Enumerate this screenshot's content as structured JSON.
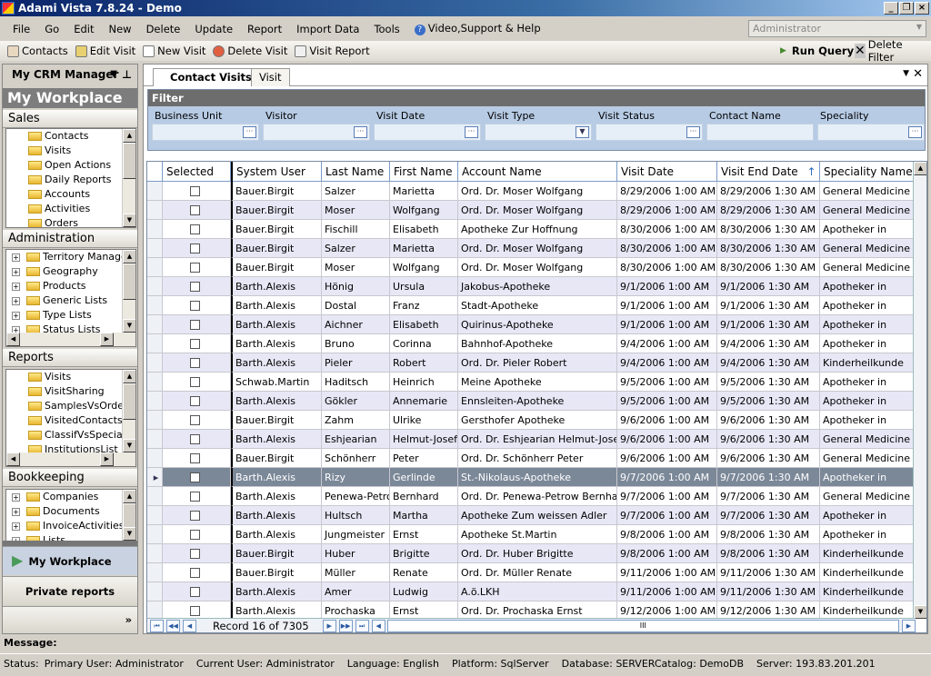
{
  "window": {
    "title": "Adami Vista 7.8.24 - Demo"
  },
  "menu": [
    "File",
    "Go",
    "Edit",
    "New",
    "Delete",
    "Update",
    "Report",
    "Import Data",
    "Tools",
    "Video,Support & Help"
  ],
  "user_combo": "Administrator",
  "toolbar": {
    "contacts": "Contacts",
    "edit_visit": "Edit Visit",
    "new_visit": "New Visit",
    "delete_visit": "Delete Visit",
    "visit_report": "Visit Report",
    "run_query": "Run Query",
    "delete_filter": "Delete Filter"
  },
  "sidebar": {
    "header": "My CRM Manager",
    "workplace_title": "My Workplace",
    "sections": [
      {
        "title": "Sales",
        "items": [
          "Contacts",
          "Visits",
          "Open Actions",
          "Daily Reports",
          "Accounts",
          "Activities",
          "Orders"
        ]
      },
      {
        "title": "Administration",
        "items": [
          "Territory Managen",
          "Geography",
          "Products",
          "Generic Lists",
          "Type Lists",
          "Status Lists"
        ]
      },
      {
        "title": "Reports",
        "items": [
          "Visits",
          "VisitSharing",
          "SamplesVsOrders",
          "VisitedContacts",
          "ClassifVsSpeciality",
          "InstitutionsList"
        ]
      },
      {
        "title": "Bookkeeping",
        "items": [
          "Companies",
          "Documents",
          "InvoiceActivities",
          "Lists"
        ]
      }
    ],
    "nav_workplace": "My Workplace",
    "nav_private": "Private reports",
    "more": "»"
  },
  "tabs": [
    "Contact Visits",
    "Visit"
  ],
  "filter": {
    "title": "Filter",
    "fields": [
      "Business Unit",
      "Visitor",
      "Visit Date",
      "Visit Type",
      "Visit Status",
      "Contact Name",
      "Speciality"
    ]
  },
  "grid": {
    "columns": [
      "Selected",
      "System User",
      "Last Name",
      "First Name",
      "Account Name",
      "Visit Date",
      "Visit End Date",
      "Speciality Name"
    ],
    "sort_column": "Visit End Date",
    "selected_row": 15,
    "rows": [
      [
        "Bauer.Birgit",
        "Salzer",
        "Marietta",
        "Ord. Dr. Moser Wolfgang",
        "8/29/2006 1:00 AM",
        "8/29/2006 1:30 AM",
        "General Medicine"
      ],
      [
        "Bauer.Birgit",
        "Moser",
        "Wolfgang",
        "Ord. Dr. Moser Wolfgang",
        "8/29/2006 1:00 AM",
        "8/29/2006 1:30 AM",
        "General Medicine"
      ],
      [
        "Bauer.Birgit",
        "Fischill",
        "Elisabeth",
        "Apotheke Zur Hoffnung",
        "8/30/2006 1:00 AM",
        "8/30/2006 1:30 AM",
        "Apotheker in"
      ],
      [
        "Bauer.Birgit",
        "Salzer",
        "Marietta",
        "Ord. Dr. Moser Wolfgang",
        "8/30/2006 1:00 AM",
        "8/30/2006 1:30 AM",
        "General Medicine"
      ],
      [
        "Bauer.Birgit",
        "Moser",
        "Wolfgang",
        "Ord. Dr. Moser Wolfgang",
        "8/30/2006 1:00 AM",
        "8/30/2006 1:30 AM",
        "General Medicine"
      ],
      [
        "Barth.Alexis",
        "Hönig",
        "Ursula",
        "Jakobus-Apotheke",
        "9/1/2006 1:00 AM",
        "9/1/2006 1:30 AM",
        "Apotheker in"
      ],
      [
        "Barth.Alexis",
        "Dostal",
        "Franz",
        "Stadt-Apotheke",
        "9/1/2006 1:00 AM",
        "9/1/2006 1:30 AM",
        "Apotheker in"
      ],
      [
        "Barth.Alexis",
        "Aichner",
        "Elisabeth",
        "Quirinus-Apotheke",
        "9/1/2006 1:00 AM",
        "9/1/2006 1:30 AM",
        "Apotheker in"
      ],
      [
        "Barth.Alexis",
        "Bruno",
        "Corinna",
        "Bahnhof-Apotheke",
        "9/4/2006 1:00 AM",
        "9/4/2006 1:30 AM",
        "Apotheker in"
      ],
      [
        "Barth.Alexis",
        "Pieler",
        "Robert",
        "Ord. Dr. Pieler Robert",
        "9/4/2006 1:00 AM",
        "9/4/2006 1:30 AM",
        "Kinderheilkunde"
      ],
      [
        "Schwab.Martin",
        "Haditsch",
        "Heinrich",
        "Meine Apotheke",
        "9/5/2006 1:00 AM",
        "9/5/2006 1:30 AM",
        "Apotheker in"
      ],
      [
        "Barth.Alexis",
        "Gökler",
        "Annemarie",
        "Ennsleiten-Apotheke",
        "9/5/2006 1:00 AM",
        "9/5/2006 1:30 AM",
        "Apotheker in"
      ],
      [
        "Bauer.Birgit",
        "Zahm",
        "Ulrike",
        "Gersthofer Apotheke",
        "9/6/2006 1:00 AM",
        "9/6/2006 1:30 AM",
        "Apotheker in"
      ],
      [
        "Barth.Alexis",
        "Eshjearian",
        "Helmut-Josef",
        "Ord. Dr. Eshjearian Helmut-Josef",
        "9/6/2006 1:00 AM",
        "9/6/2006 1:30 AM",
        "General Medicine"
      ],
      [
        "Bauer.Birgit",
        "Schönherr",
        "Peter",
        "Ord. Dr. Schönherr Peter",
        "9/6/2006 1:00 AM",
        "9/6/2006 1:30 AM",
        "General Medicine"
      ],
      [
        "Barth.Alexis",
        "Rizy",
        "Gerlinde",
        "St.-Nikolaus-Apotheke",
        "9/7/2006 1:00 AM",
        "9/7/2006 1:30 AM",
        "Apotheker in"
      ],
      [
        "Barth.Alexis",
        "Penewa-Petro",
        "Bernhard",
        "Ord. Dr. Penewa-Petrow Bernhard",
        "9/7/2006 1:00 AM",
        "9/7/2006 1:30 AM",
        "General Medicine"
      ],
      [
        "Barth.Alexis",
        "Hultsch",
        "Martha",
        "Apotheke Zum weissen Adler",
        "9/7/2006 1:00 AM",
        "9/7/2006 1:30 AM",
        "Apotheker in"
      ],
      [
        "Barth.Alexis",
        "Jungmeister",
        "Ernst",
        "Apotheke St.Martin",
        "9/8/2006 1:00 AM",
        "9/8/2006 1:30 AM",
        "Apotheker in"
      ],
      [
        "Bauer.Birgit",
        "Huber",
        "Brigitte",
        "Ord. Dr. Huber Brigitte",
        "9/8/2006 1:00 AM",
        "9/8/2006 1:30 AM",
        "Kinderheilkunde"
      ],
      [
        "Bauer.Birgit",
        "Müller",
        "Renate",
        "Ord. Dr. Müller Renate",
        "9/11/2006 1:00 AM",
        "9/11/2006 1:30 AM",
        "Kinderheilkunde"
      ],
      [
        "Barth.Alexis",
        "Amer",
        "Ludwig",
        "A.ö.LKH",
        "9/11/2006 1:00 AM",
        "9/11/2006 1:30 AM",
        "Kinderheilkunde"
      ],
      [
        "Barth.Alexis",
        "Prochaska",
        "Ernst",
        "Ord. Dr. Prochaska Ernst",
        "9/12/2006 1:00 AM",
        "9/12/2006 1:30 AM",
        "Kinderheilkunde"
      ]
    ],
    "record_text": "Record 16 of 7305"
  },
  "message_label": "Message:",
  "status": {
    "label": "Status:",
    "primary_user": "Primary User: Administrator",
    "current_user": "Current User: Administrator",
    "language": "Language: English",
    "platform": "Platform: SqlServer",
    "database": "Database: SERVERCatalog: DemoDB",
    "server": "Server: 193.83.201.201"
  }
}
